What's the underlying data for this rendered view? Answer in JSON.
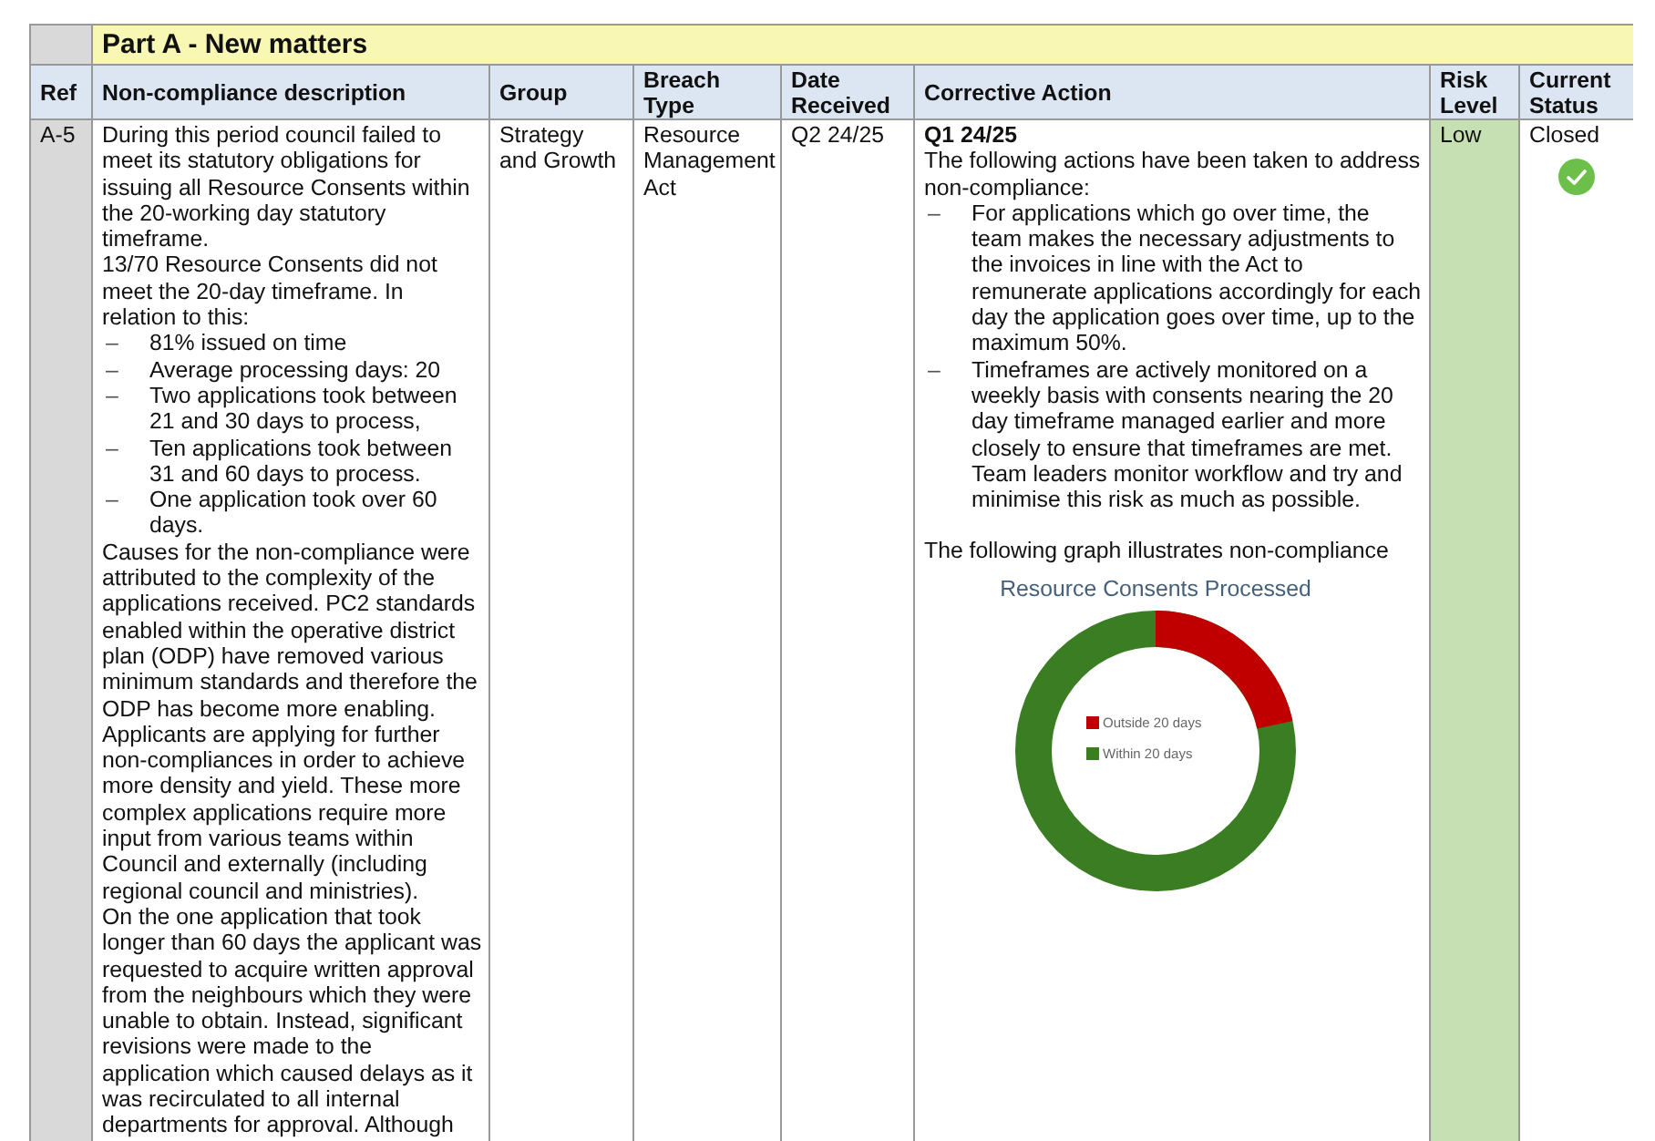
{
  "section_title": "Part A - New matters",
  "columns": [
    "Ref",
    "Non-compliance description",
    "Group",
    "Breach Type",
    "Date Received",
    "Corrective Action",
    "Risk Level",
    "Current Status"
  ],
  "row": {
    "ref": "A-5",
    "description": [
      {
        "kind": "para",
        "text": "During this period council failed to meet its statutory obligations for issuing all Resource Consents within the 20-working day statutory timeframe."
      },
      {
        "kind": "para",
        "text": "13/70 Resource Consents did not meet the 20-day timeframe. In relation to this:"
      },
      {
        "kind": "bullet",
        "marker": "–",
        "text": "81% issued on time"
      },
      {
        "kind": "bullet",
        "marker": "–",
        "text": "Average processing days: 20"
      },
      {
        "kind": "bullet",
        "marker": "–",
        "text": "Two applications took between 21 and 30 days to process,"
      },
      {
        "kind": "bullet",
        "marker": "–",
        "text": "Ten applications took between 31 and 60 days to process."
      },
      {
        "kind": "bullet",
        "marker": "–",
        "text": "One application took over 60 days."
      },
      {
        "kind": "para",
        "text": "Causes for the non-compliance were attributed to the complexity of the applications received. PC2 standards enabled within the operative district plan (ODP) have removed various minimum standards and therefore the ODP has become more enabling. Applicants are applying for further non-compliances in order to achieve more density and yield. These more complex applications require more input from various teams within Council and externally (including regional council and ministries)."
      },
      {
        "kind": "para",
        "text": "On the one application that took longer than 60 days the applicant was requested to acquire written approval from the neighbours which they were unable to obtain. Instead, significant revisions were made to the application which caused delays as it was recirculated to all internal departments for approval. Although"
      }
    ],
    "group": "Strategy and Growth",
    "breach_type": "Resource Management Act",
    "date_received": "Q2 24/25",
    "corrective_action": [
      {
        "kind": "heading",
        "text": "Q1 24/25"
      },
      {
        "kind": "para",
        "text": "The following actions have been taken to address non-compliance:"
      },
      {
        "kind": "bullet",
        "marker": "–",
        "text": "For applications which go over time, the team makes the necessary adjustments to the invoices in line with the Act to remunerate applications accordingly for each day the application goes over time, up to the maximum 50%."
      },
      {
        "kind": "bullet",
        "marker": "–",
        "text": "Timeframes are actively monitored on a weekly basis with consents nearing the 20 day timeframe managed earlier and more closely to ensure that timeframes are met. Team leaders monitor workflow and try and minimise this risk as much as possible."
      },
      {
        "kind": "gap"
      },
      {
        "kind": "para",
        "text": "The following graph illustrates non-compliance"
      },
      {
        "kind": "chart",
        "title": "Resource Consents Processed",
        "legend": [
          {
            "label": "Outside 20 days",
            "color": "#c00000"
          },
          {
            "label": "Within 20 days",
            "color": "#3a7d22"
          }
        ]
      }
    ],
    "risk_level": "Low",
    "status": "Closed"
  }
}
